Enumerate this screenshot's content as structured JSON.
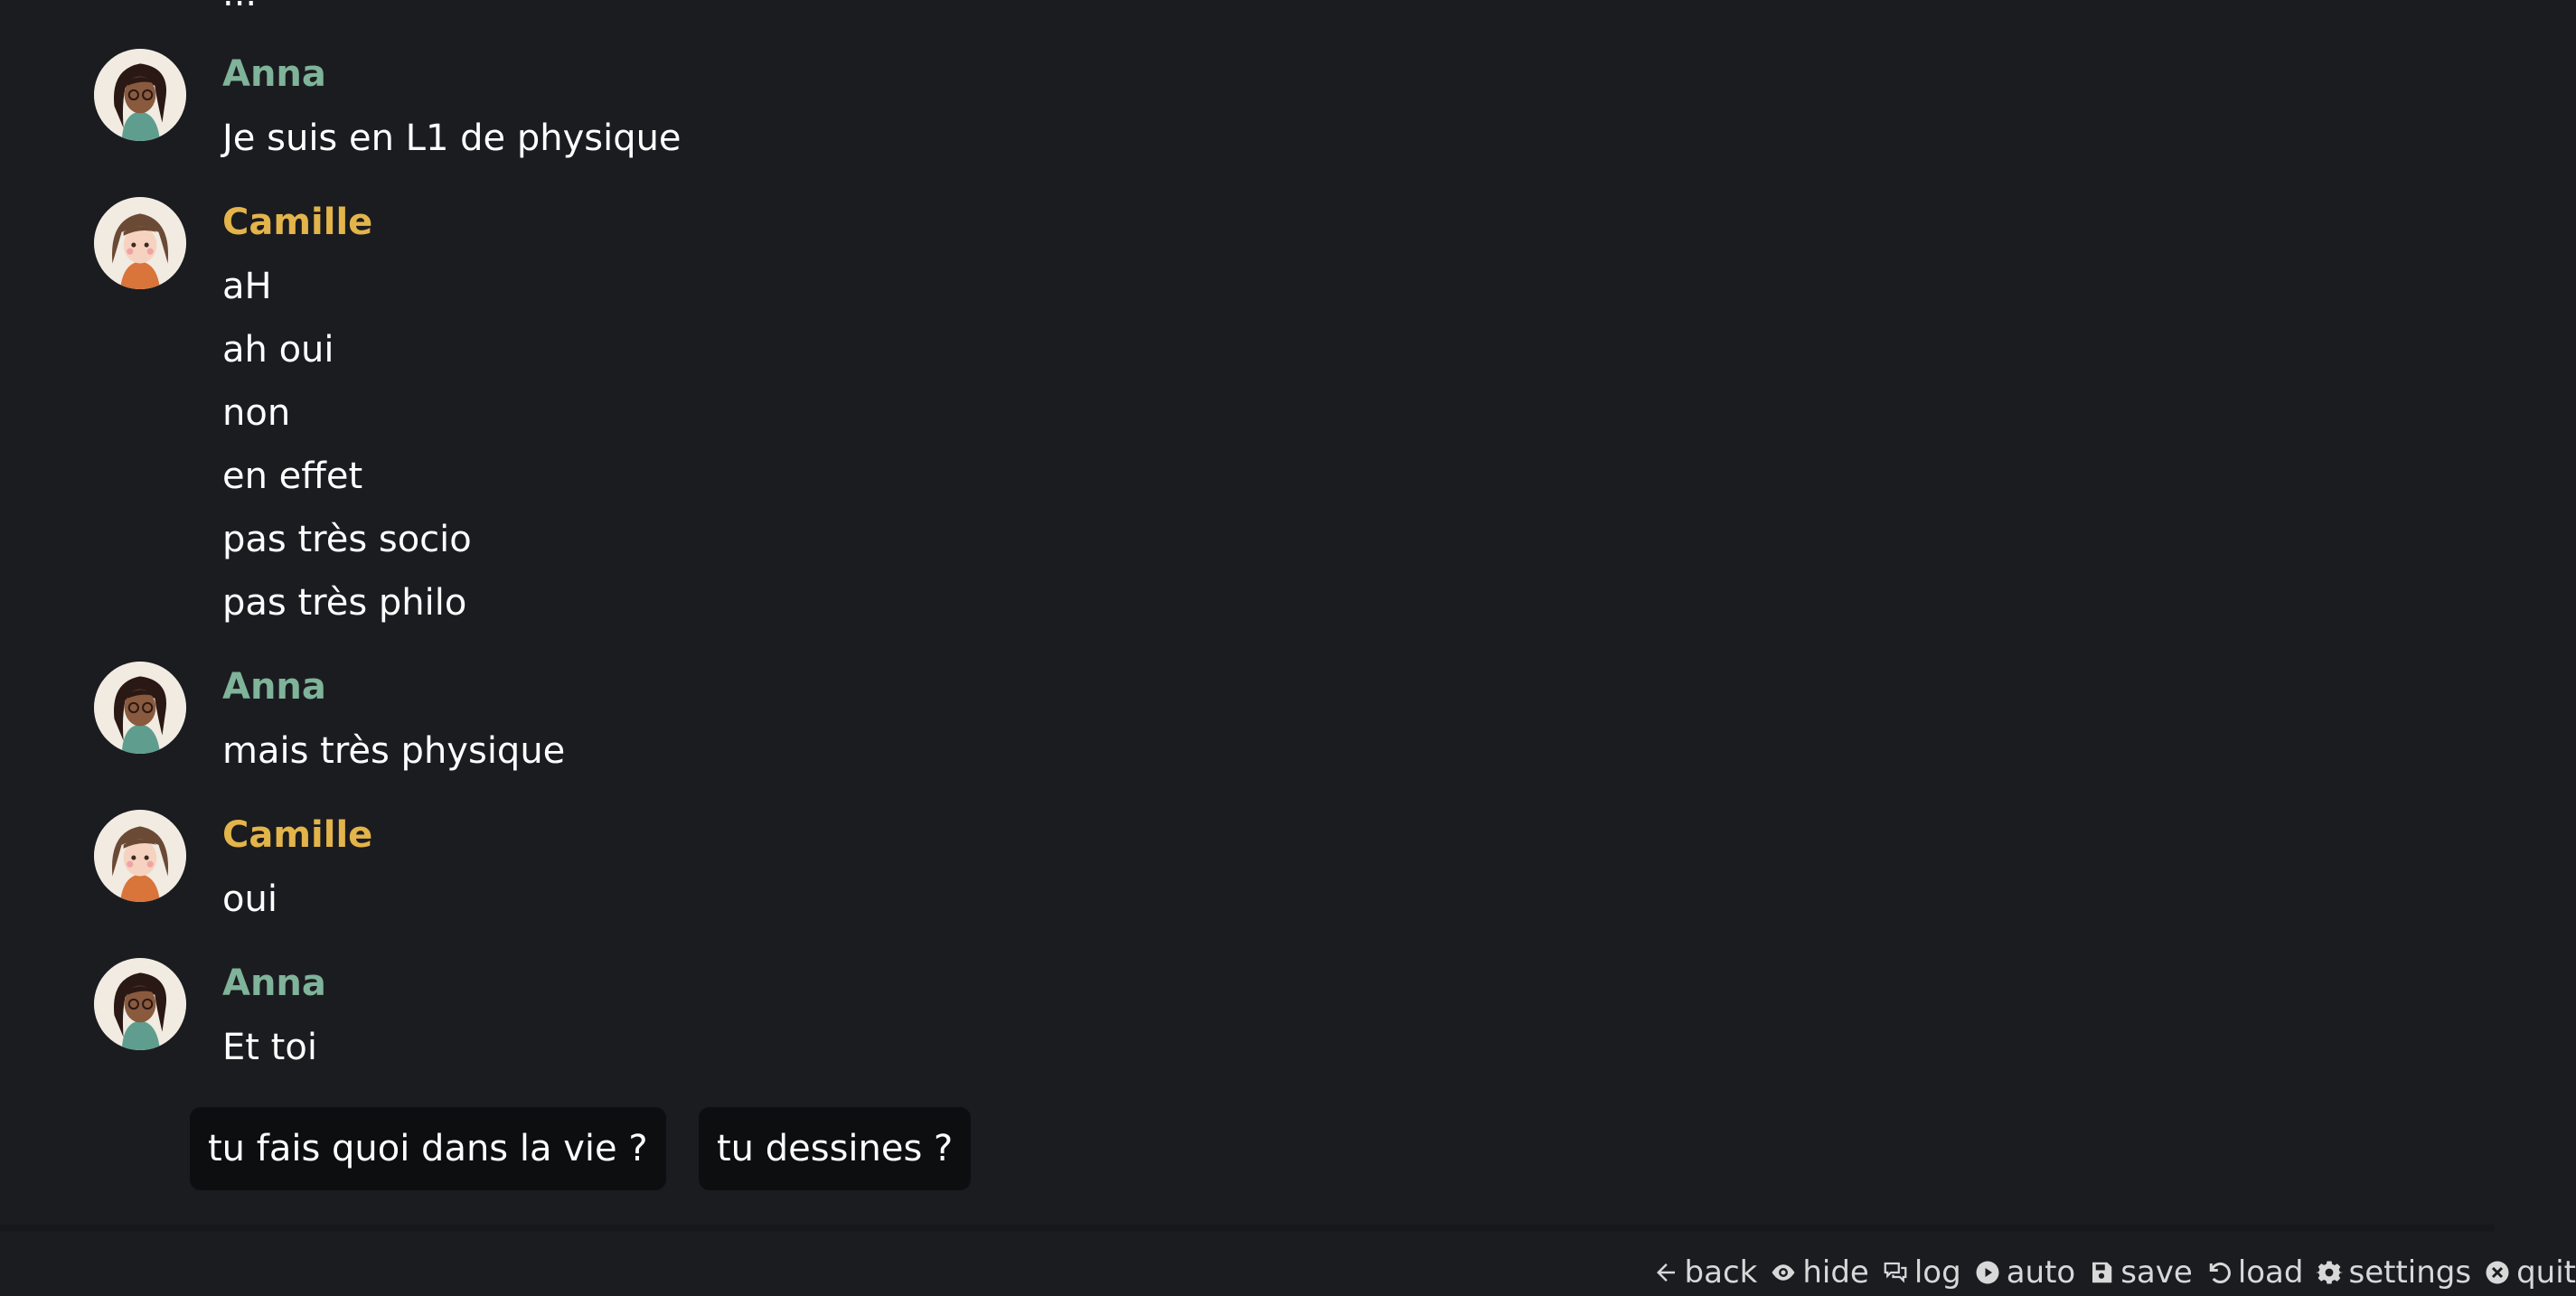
{
  "partial_previous_line": "...",
  "colors": {
    "background": "#1b1c20",
    "anna": "#7fb39a",
    "camille": "#e3b44a",
    "text": "#ffffff",
    "choice_bg": "#0d0e10"
  },
  "messages": [
    {
      "speaker": "Anna",
      "avatar": "anna-avatar",
      "lines": [
        "Je suis en L1 de physique"
      ]
    },
    {
      "speaker": "Camille",
      "avatar": "camille-avatar",
      "lines": [
        "aH",
        "ah oui",
        "non",
        "en effet",
        "pas très socio",
        "pas très philo"
      ]
    },
    {
      "speaker": "Anna",
      "avatar": "anna-avatar",
      "lines": [
        "mais très physique"
      ]
    },
    {
      "speaker": "Camille",
      "avatar": "camille-avatar",
      "lines": [
        "oui"
      ]
    },
    {
      "speaker": "Anna",
      "avatar": "anna-avatar",
      "lines": [
        "Et toi"
      ]
    }
  ],
  "choices": [
    {
      "label": "tu fais quoi dans la vie ?"
    },
    {
      "label": "tu dessines ?"
    }
  ],
  "quick_menu": [
    {
      "label": "back",
      "icon": "arrow-left-icon"
    },
    {
      "label": "hide",
      "icon": "eye-icon"
    },
    {
      "label": "log",
      "icon": "chat-bubbles-icon"
    },
    {
      "label": "auto",
      "icon": "play-circle-icon"
    },
    {
      "label": "save",
      "icon": "floppy-disk-icon"
    },
    {
      "label": "load",
      "icon": "undo-icon"
    },
    {
      "label": "settings",
      "icon": "gear-icon"
    },
    {
      "label": "quit",
      "icon": "close-circle-icon"
    }
  ]
}
